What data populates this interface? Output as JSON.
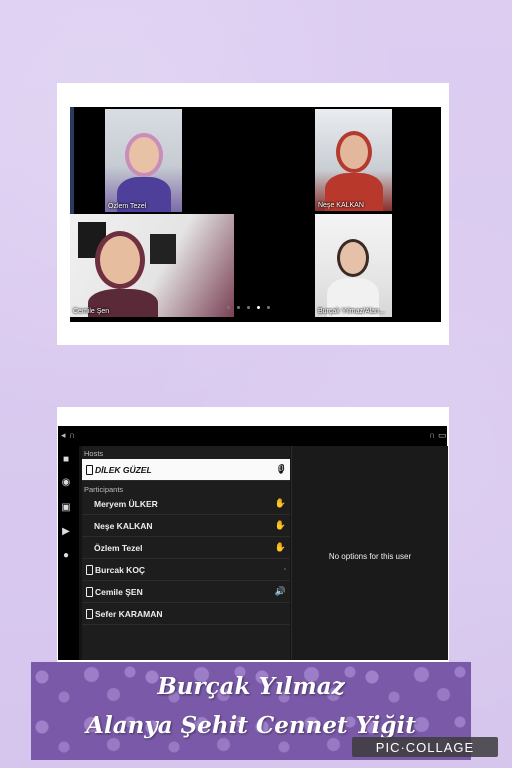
{
  "video_call": {
    "tiles": [
      {
        "name": "Özlem Tezel"
      },
      {
        "name": "Neşe KALKAN"
      },
      {
        "name": "Cemile Şen"
      },
      {
        "name": "Burçak Yılmaz/Alan..."
      }
    ],
    "page_indicator": {
      "pages": 5,
      "current": 4
    }
  },
  "participants_panel": {
    "hosts_label": "Hosts",
    "participants_label": "Participants",
    "host": {
      "name": "DİLEK GÜZEL",
      "icon": "microphone-icon"
    },
    "participants": [
      {
        "name": "Meryem ÜLKER",
        "icon": "raised-hand-icon",
        "device": false
      },
      {
        "name": "Neşe KALKAN",
        "icon": "raised-hand-icon",
        "device": false
      },
      {
        "name": "Özlem Tezel",
        "icon": "raised-hand-icon",
        "device": false
      },
      {
        "name": "Burcak KOÇ",
        "icon": "small-mark-icon",
        "device": true
      },
      {
        "name": "Cemile ŞEN",
        "icon": "speaker-icon",
        "device": true
      },
      {
        "name": "Sefer KARAMAN",
        "icon": "",
        "device": true
      }
    ],
    "detail_message": "No options for this user"
  },
  "banner": {
    "line1": "Burçak Yılmaz",
    "line2": "Alanya Şehit Cennet Yiğit"
  },
  "watermark": "PIC·COLLAGE",
  "colors": {
    "background": "#d9c9ef",
    "banner": "#7a5aa8",
    "raised_hand": "#3e8ee6"
  }
}
